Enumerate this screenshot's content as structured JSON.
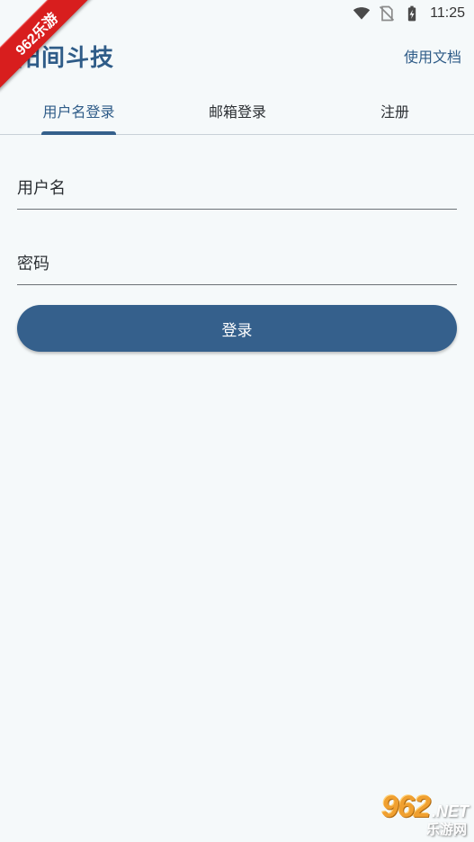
{
  "status_bar": {
    "time": "11:25",
    "icons": [
      "wifi-icon",
      "no-sim-icon",
      "battery-charging-icon"
    ]
  },
  "ribbon": {
    "text": "962乐游"
  },
  "app_bar": {
    "title": "阳间斗技",
    "action_label": "使用文档"
  },
  "tabs": [
    {
      "label": "用户名登录",
      "active": true
    },
    {
      "label": "邮箱登录",
      "active": false
    },
    {
      "label": "注册",
      "active": false
    }
  ],
  "form": {
    "username": {
      "value": "",
      "placeholder": "用户名"
    },
    "password": {
      "value": "",
      "placeholder": "密码"
    },
    "submit_label": "登录"
  },
  "watermark": {
    "number": "962",
    "suffix": ".NET",
    "sub": "乐游网"
  },
  "colors": {
    "primary": "#35608c",
    "title": "#2f5c88",
    "background": "#f5f9fa",
    "ribbon": "#d81e1e"
  }
}
